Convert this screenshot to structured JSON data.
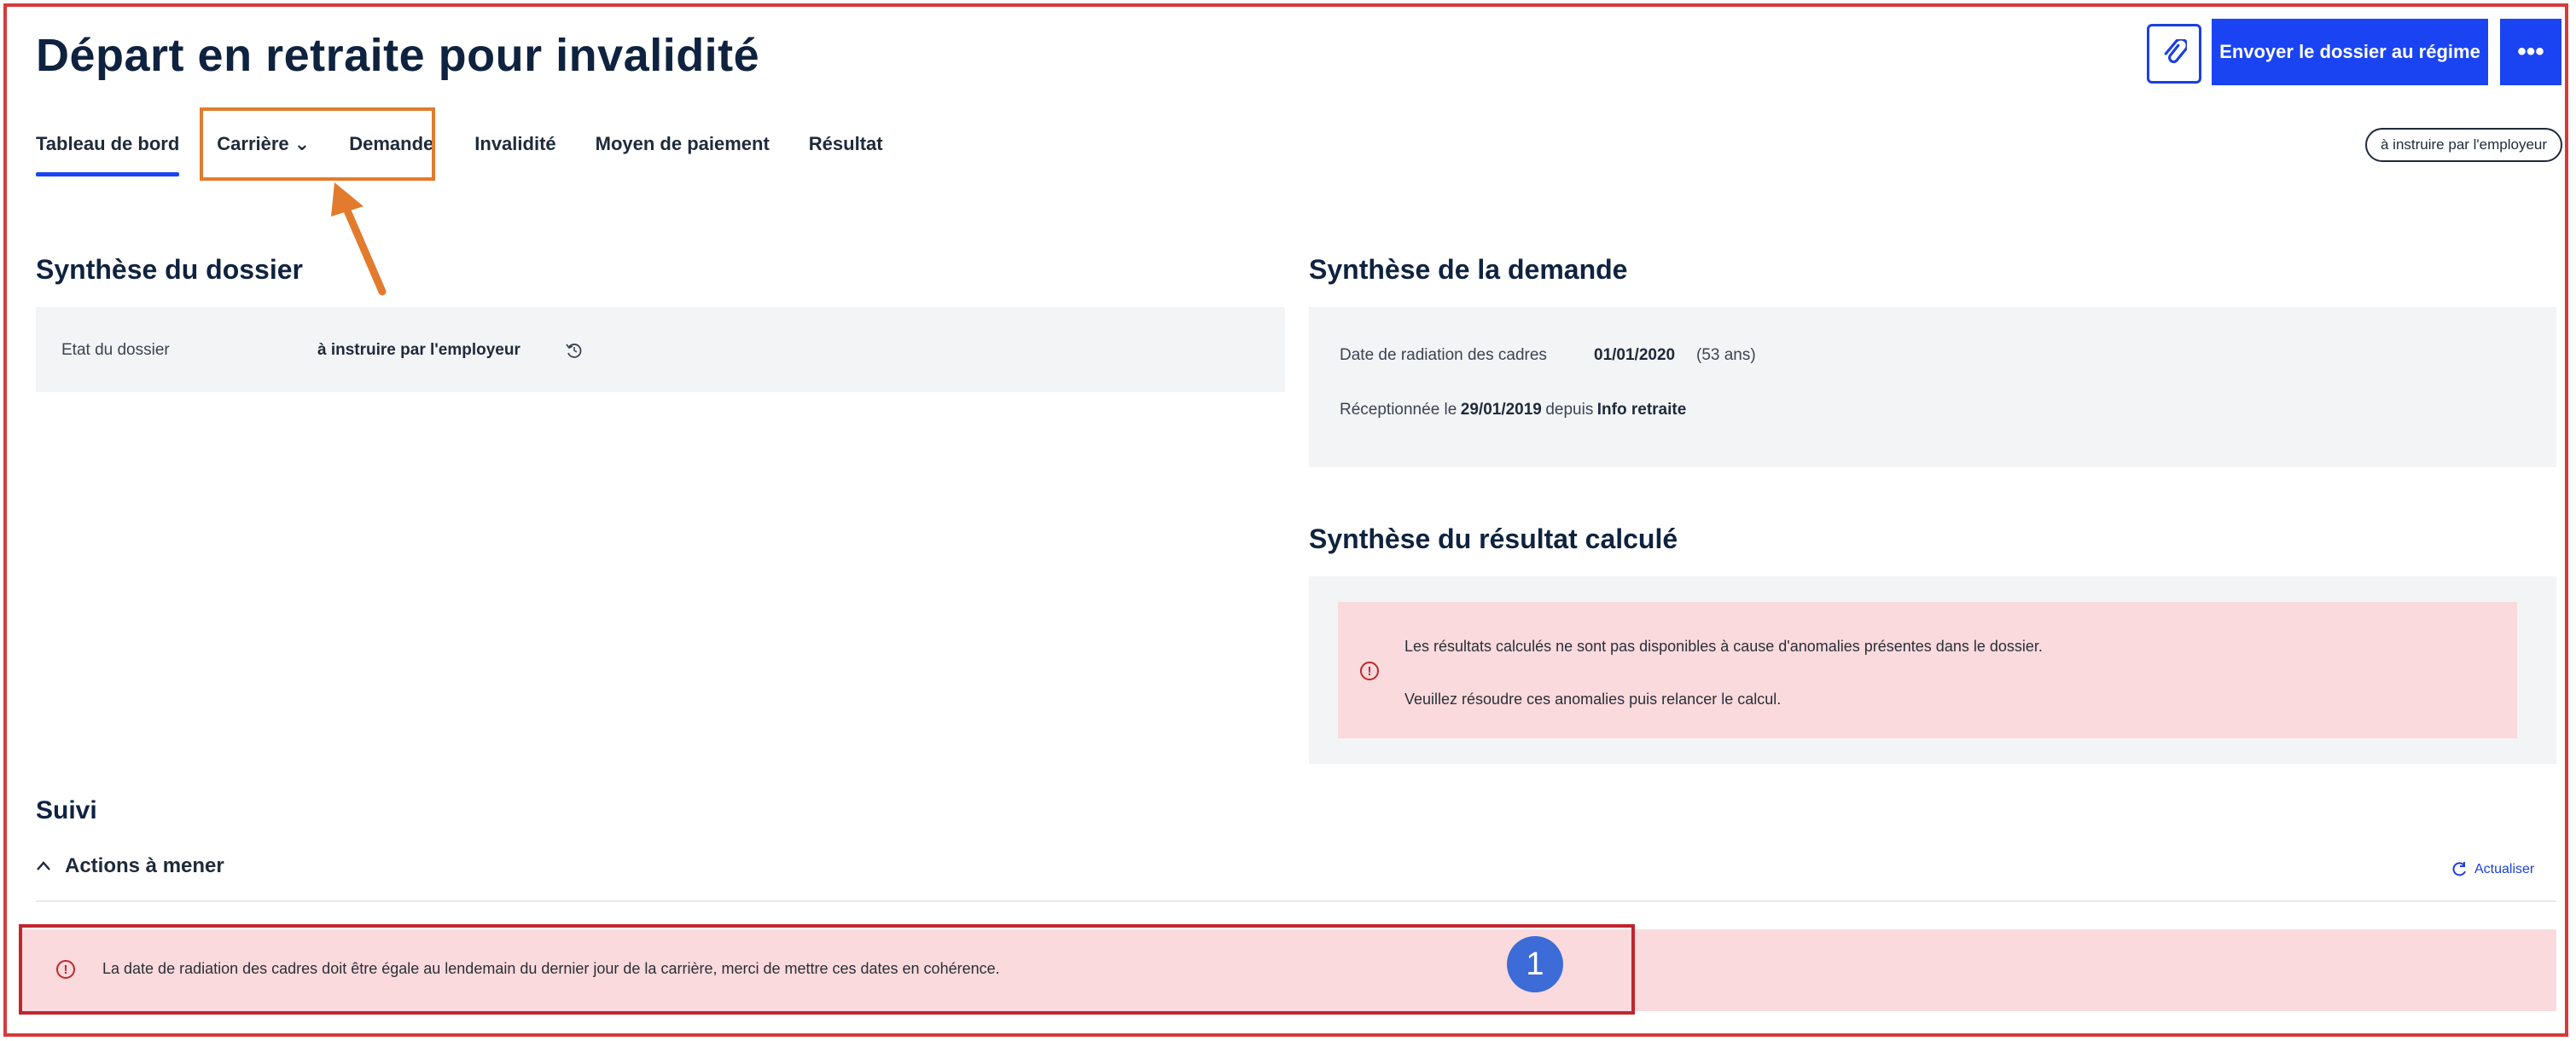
{
  "header": {
    "title": "Départ en retraite pour invalidité",
    "send_button": "Envoyer le dossier au régime",
    "more_button": "•••",
    "clip_icon": "paperclip-icon",
    "status_pill": "à instruire par l'employeur"
  },
  "tabs": [
    {
      "label": "Tableau de bord"
    },
    {
      "label": "Carrière ⌄"
    },
    {
      "label": "Demande"
    },
    {
      "label": "Invalidité"
    },
    {
      "label": "Moyen de paiement"
    },
    {
      "label": "Résultat"
    }
  ],
  "synthese_dossier": {
    "title": "Synthèse du dossier",
    "etat_label": "Etat du dossier",
    "etat_value": "à instruire par l'employeur",
    "history_icon": "history-icon"
  },
  "synthese_demande": {
    "title": "Synthèse de la demande",
    "date_label": "Date de radiation des cadres",
    "date_value": "01/01/2020",
    "age": "(53 ans)",
    "recep_prefix": "Réceptionnée le",
    "recep_date": "29/01/2019",
    "recep_mid": "depuis",
    "recep_source": "Info retraite"
  },
  "synthese_resultat": {
    "title": "Synthèse du résultat calculé",
    "alert_line1": "Les résultats calculés ne sont pas disponibles à cause d'anomalies présentes dans le dossier.",
    "alert_line2": "Veuillez résoudre ces anomalies puis relancer le calcul.",
    "alert_icon": "!"
  },
  "suivi": {
    "title": "Suivi",
    "actions_title": "Actions à mener",
    "actions_chevron": "^",
    "refresh_label": "Actualiser",
    "alert_icon": "!",
    "action_alert": "La date de radiation des cadres doit être égale au lendemain du dernier jour de la carrière, merci de mettre ces dates en cohérence."
  },
  "annotation": {
    "badge": "1",
    "colors": {
      "orange": "#e27b2e",
      "red": "#d63a3a",
      "blue": "#3d6bd8"
    }
  }
}
